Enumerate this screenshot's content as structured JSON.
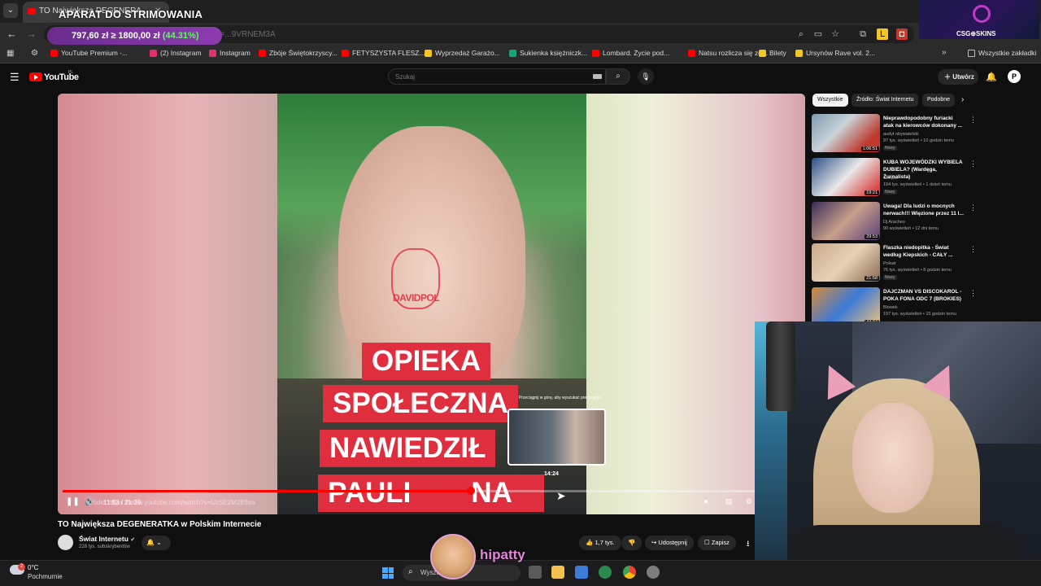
{
  "browser": {
    "tab_title": "TO Największa DEGENERA...",
    "stream_overlay_title": "APARAT DO STRIMOWANIA",
    "price_main": "797,60 zł ≥ 1800,00 zł",
    "price_pct": "(44.31%)",
    "url_fragment": "?v=...9VRNEM3A",
    "bookmarks": [
      {
        "label": "YouTube Premium -...",
        "color": "#ff0000"
      },
      {
        "label": "(2) Instagram",
        "color": "#e1306c"
      },
      {
        "label": "Instagram",
        "color": "#e1306c"
      },
      {
        "label": "Zbóje Świętokrzyscy...",
        "color": "#ff0000"
      },
      {
        "label": "FETYSZYSTA FLESZ...",
        "color": "#ff0000"
      },
      {
        "label": "Wyprzedaż Garażo...",
        "color": "#f3c623"
      },
      {
        "label": "Sukienka księżniczk...",
        "color": "#1aa37a"
      },
      {
        "label": "Lombard. Życie pod...",
        "color": "#ff0000"
      },
      {
        "label": "Natsu rozlicza się ze...",
        "color": "#ff0000"
      },
      {
        "label": "Bilety",
        "color": "#f3c623"
      },
      {
        "label": "Ursynów Rave vol. 2...",
        "color": "#f3c623"
      }
    ],
    "all_bookmarks": "Wszystkie zakładki"
  },
  "csgo": {
    "label": "CSG⊕SKINS"
  },
  "youtube": {
    "wordmark": "YouTube",
    "country": "PL",
    "search_placeholder": "Szukaj",
    "create_label": "Utwórz",
    "avatar_letter": "P"
  },
  "video": {
    "captions": [
      "OPIEKA",
      "SPOŁECZNA",
      "NAWIEDZIŁ",
      "PAULI",
      "NA"
    ],
    "watermark": "DAVIDPOL",
    "preview_hint": "Przeciągnij w górę, aby wyszukać precyzyjnie",
    "preview_time": "14:24",
    "timecode": "11:53 / 21:29",
    "source_url": "Źródło: https://www.youtube.com/watch?v=UzSE2M283ws",
    "progress_fraction": 0.553,
    "title": "TO Największa DEGENERATKA w Polskim Internecie",
    "channel": "Świat Internetu",
    "subscribers": "228 tys. subskrybentów",
    "likes": "1,7 tys.",
    "share_label": "Udostępnij",
    "save_label": "Zapisz"
  },
  "sidebar": {
    "chips": [
      "Wszystkie",
      "Źródło: Świat Internetu",
      "Podobne"
    ],
    "recommendations": [
      {
        "title": "Nieprawdopodobny furiacki atak na kierowców dokonany ...",
        "channel": "audyt obywatelski",
        "meta": "97 tys. wyświetleń • 10 godzin temu",
        "badge": "Nowy",
        "duration": "1:06:51"
      },
      {
        "title": "KUBA WOJEWÓDZKI WYBIELA DUBIELA? (Wardęga, Żurnalista)",
        "channel": "Gimper",
        "meta": "194 tys. wyświetleń • 1 dzień temu",
        "badge": "Nowy",
        "duration": "19:21"
      },
      {
        "title": "Uwaga! Dla ludzi o mocnych nerwach!!! Więzione przez 11 l...",
        "channel": "Dj Aracheo",
        "meta": "90 wyświetleń • 12 dni temu",
        "badge": "",
        "duration": "29:53"
      },
      {
        "title": "Flaszka niedopitka - Świat według Kiepskich - CAŁY ...",
        "channel": "Polsat",
        "meta": "76 tys. wyświetleń • 8 godzin temu",
        "badge": "Nowy",
        "duration": "21:58"
      },
      {
        "title": "DAJCZMAN VS DISCOKAROL - POKA FONA ODC 7 (BROKIES)",
        "channel": "Blowek",
        "meta": "197 tys. wyświetleń • 15 godzin temu",
        "badge": "",
        "duration": "44:37"
      }
    ]
  },
  "overlay": {
    "streamer_name": "hipatty"
  },
  "taskbar": {
    "temperature": "0°C",
    "weather": "Pochmurnie",
    "weather_badge": "2",
    "search_label": "Wyszukaj"
  },
  "colors": {
    "accent": "#ff0000",
    "caption_bg": "#df2e3e",
    "overlay_name": "#e884e0"
  }
}
